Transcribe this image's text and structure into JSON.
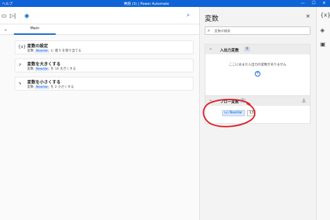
{
  "window": {
    "help_label": "ヘルプ",
    "title": "無題 (3) | Power Automate",
    "minimize": "—",
    "maximize": "☐",
    "close": "✕"
  },
  "toolbar": {
    "search_icon": "search-icon"
  },
  "subflows": {
    "tab_main": "Main"
  },
  "actions": [
    {
      "num": "{x}",
      "title": "変数の設定",
      "pre": "変数",
      "var": "NewVar",
      "post": "に 値 5 を割り当てる",
      "icon": "variable-icon"
    },
    {
      "num": "↗",
      "title": "変数を大きくする",
      "pre": "変数",
      "var": "NewVar",
      "post": "を 10 大きくする",
      "icon": "increase-icon"
    },
    {
      "num": "↘",
      "title": "変数を小さくする",
      "pre": "変数",
      "var": "NewVar",
      "post": "を 2 小さくする",
      "icon": "decrease-icon"
    }
  ],
  "variables_panel": {
    "title": "変数",
    "search_placeholder": "変数の検索",
    "io_section": {
      "label": "入出力変数",
      "count": "0",
      "empty_message": "ここにはまだ入出力の変数がありません"
    },
    "flow_section": {
      "label": "フロー変数",
      "count": "1",
      "variables": [
        {
          "prefix": "(x)",
          "name": "NewVar",
          "value": "13"
        }
      ]
    }
  },
  "colors": {
    "accent": "#0e63d6",
    "annotation": "#e0202a"
  }
}
